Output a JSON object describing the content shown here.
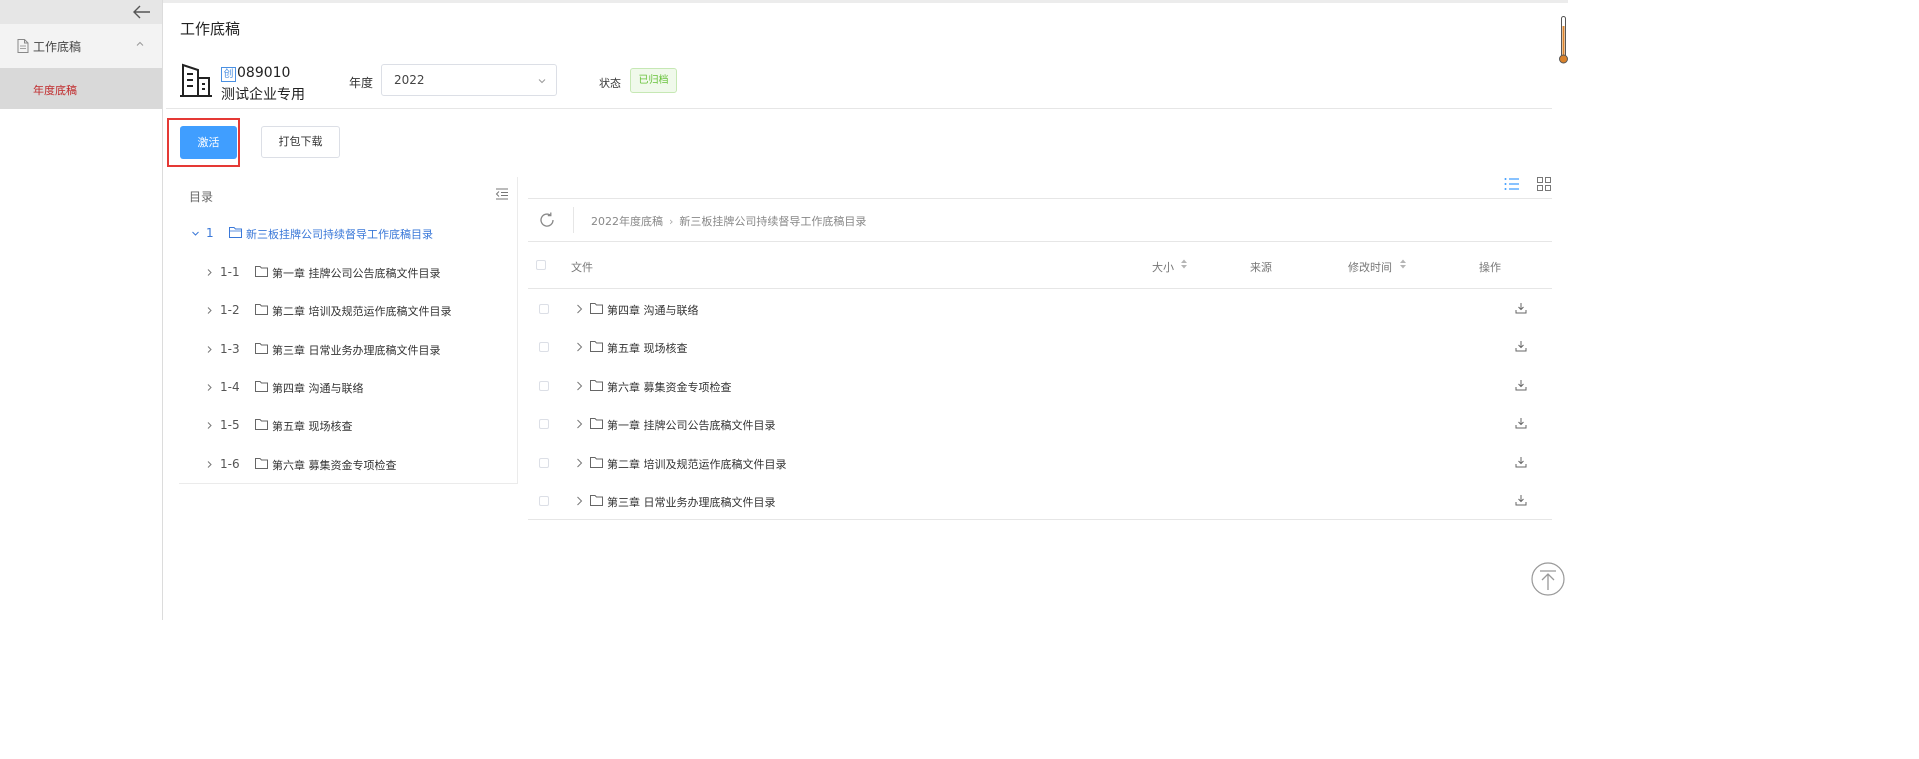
{
  "sidebar": {
    "group_label": "工作底稿",
    "item_label": "年度底稿"
  },
  "header": {
    "title": "工作底稿",
    "corp_badge": "创",
    "corp_code": "089010",
    "corp_name": "测试企业专用",
    "year_label": "年度",
    "year_value": "2022",
    "status_label": "状态",
    "status_value": "已归档"
  },
  "actions": {
    "activate": "激活",
    "download": "打包下载"
  },
  "tree": {
    "header": "目录",
    "root": {
      "num": "1",
      "label": "新三板挂牌公司持续督导工作底稿目录"
    },
    "children": [
      {
        "num": "1-1",
        "label": "第一章 挂牌公司公告底稿文件目录"
      },
      {
        "num": "1-2",
        "label": "第二章 培训及规范运作底稿文件目录"
      },
      {
        "num": "1-3",
        "label": "第三章 日常业务办理底稿文件目录"
      },
      {
        "num": "1-4",
        "label": "第四章 沟通与联络"
      },
      {
        "num": "1-5",
        "label": "第五章 现场核查"
      },
      {
        "num": "1-6",
        "label": "第六章 募集资金专项检查"
      }
    ]
  },
  "breadcrumb": [
    "2022年度底稿",
    "新三板挂牌公司持续督导工作底稿目录"
  ],
  "table": {
    "columns": {
      "file": "文件",
      "size": "大小",
      "source": "来源",
      "modified": "修改时间",
      "ops": "操作"
    },
    "rows": [
      {
        "name": "第四章 沟通与联络"
      },
      {
        "name": "第五章 现场核查"
      },
      {
        "name": "第六章 募集资金专项检查"
      },
      {
        "name": "第一章 挂牌公司公告底稿文件目录"
      },
      {
        "name": "第二章 培训及规范运作底稿文件目录"
      },
      {
        "name": "第三章 日常业务办理底稿文件目录"
      }
    ]
  },
  "colors": {
    "primary": "#409eff",
    "link_blue": "#3a78d8",
    "sidebar_active_text": "#c0292b",
    "status_green": "#67c23a",
    "highlight_red": "#e53935"
  },
  "icons": {
    "back": "arrow-left-icon",
    "doc": "document-icon",
    "building": "building-icon",
    "folder": "folder-icon",
    "refresh": "refresh-icon",
    "download": "download-icon",
    "list_view": "list-view-icon",
    "grid_view": "grid-view-icon",
    "back_to_top": "back-to-top-icon"
  }
}
